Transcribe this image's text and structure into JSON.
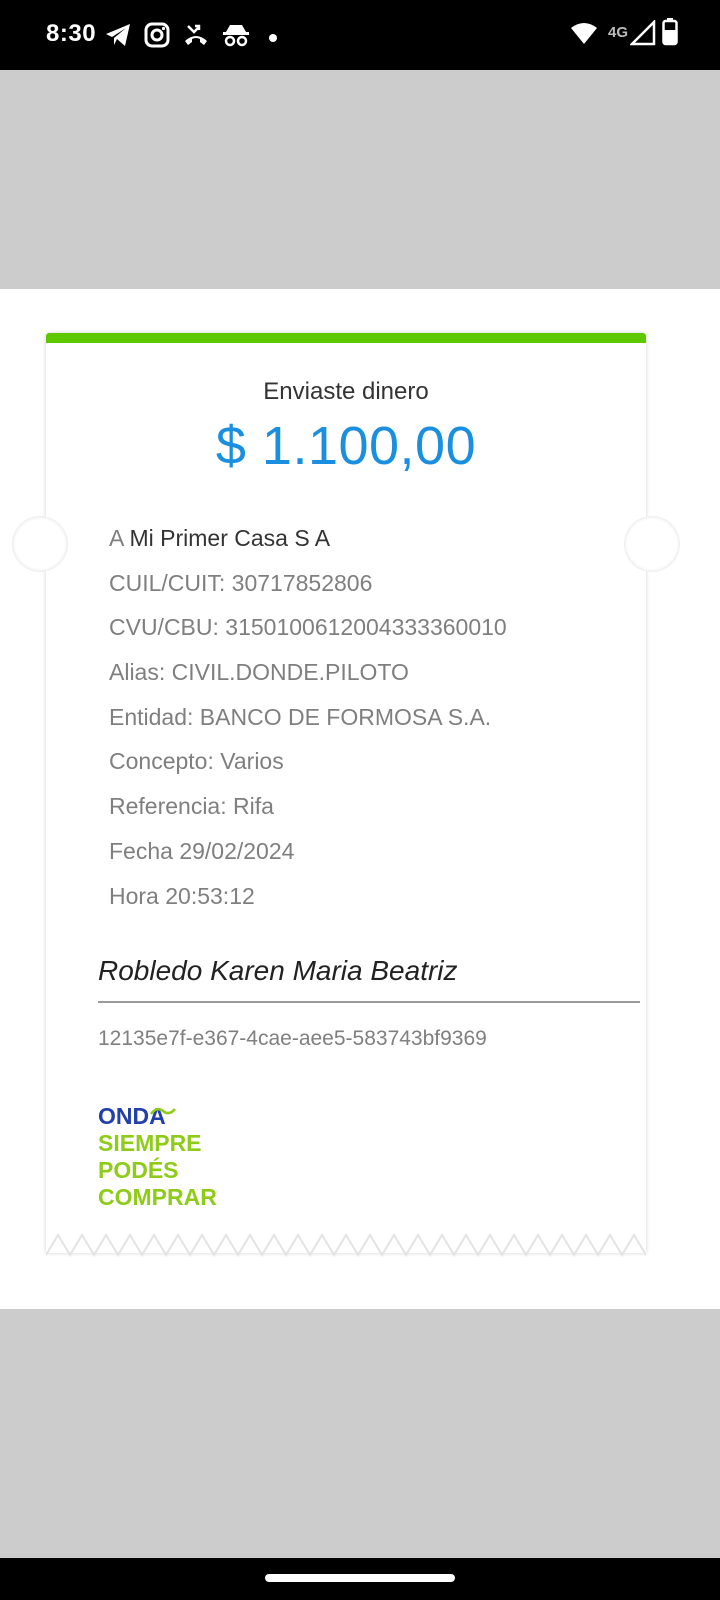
{
  "status_bar": {
    "time": "8:30",
    "network": "4G",
    "icons_left": [
      "telegram-icon",
      "instagram-icon",
      "missed-call-icon",
      "incognito-icon",
      "notification-dot-icon"
    ],
    "icons_right": [
      "wifi-icon",
      "signal-icon",
      "battery-icon"
    ]
  },
  "receipt": {
    "title": "Enviaste dinero",
    "amount": "$ 1.100,00",
    "recipient_prefix": "A ",
    "recipient_name": "Mi Primer Casa S A",
    "details": [
      "CUIL/CUIT: 30717852806",
      "CVU/CBU: 3150100612004333360010",
      "Alias: CIVIL.DONDE.PILOTO",
      "Entidad: BANCO DE FORMOSA S.A.",
      "Concepto: Varios",
      "Referencia: Rifa",
      "Fecha 29/02/2024",
      "Hora 20:53:12"
    ],
    "signer": "Robledo Karen Maria Beatriz",
    "transaction_id": "12135e7f-e367-4cae-aee5-583743bf9369",
    "logo": {
      "brand": "ONDA",
      "line1": "SIEMPRE",
      "line2": "PODÉS",
      "line3": "COMPRAR"
    }
  },
  "colors": {
    "stripe": "#5dc800",
    "amount": "#1a8fe0",
    "logo_blue": "#2340a8",
    "logo_green": "#8fcc1a"
  }
}
